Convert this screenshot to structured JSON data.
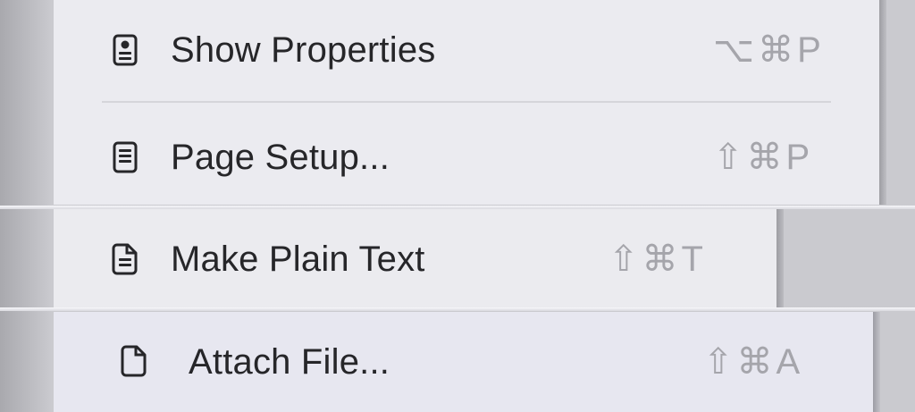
{
  "menu": {
    "items": [
      {
        "label": "Show Properties",
        "shortcut": "⌥⌘P",
        "icon": "properties-icon"
      },
      {
        "label": "Page Setup...",
        "shortcut": "⇧⌘P",
        "icon": "page-setup-icon"
      },
      {
        "label": "Make Plain Text",
        "shortcut": "⇧⌘T",
        "icon": "plain-text-icon"
      },
      {
        "label": "Attach File...",
        "shortcut": "⇧⌘A",
        "icon": "attach-file-icon"
      }
    ]
  },
  "colors": {
    "label": "#262629",
    "shortcut": "#a5a5ab",
    "menu_background": "#ebebf0",
    "separator": "#d5d5da"
  }
}
